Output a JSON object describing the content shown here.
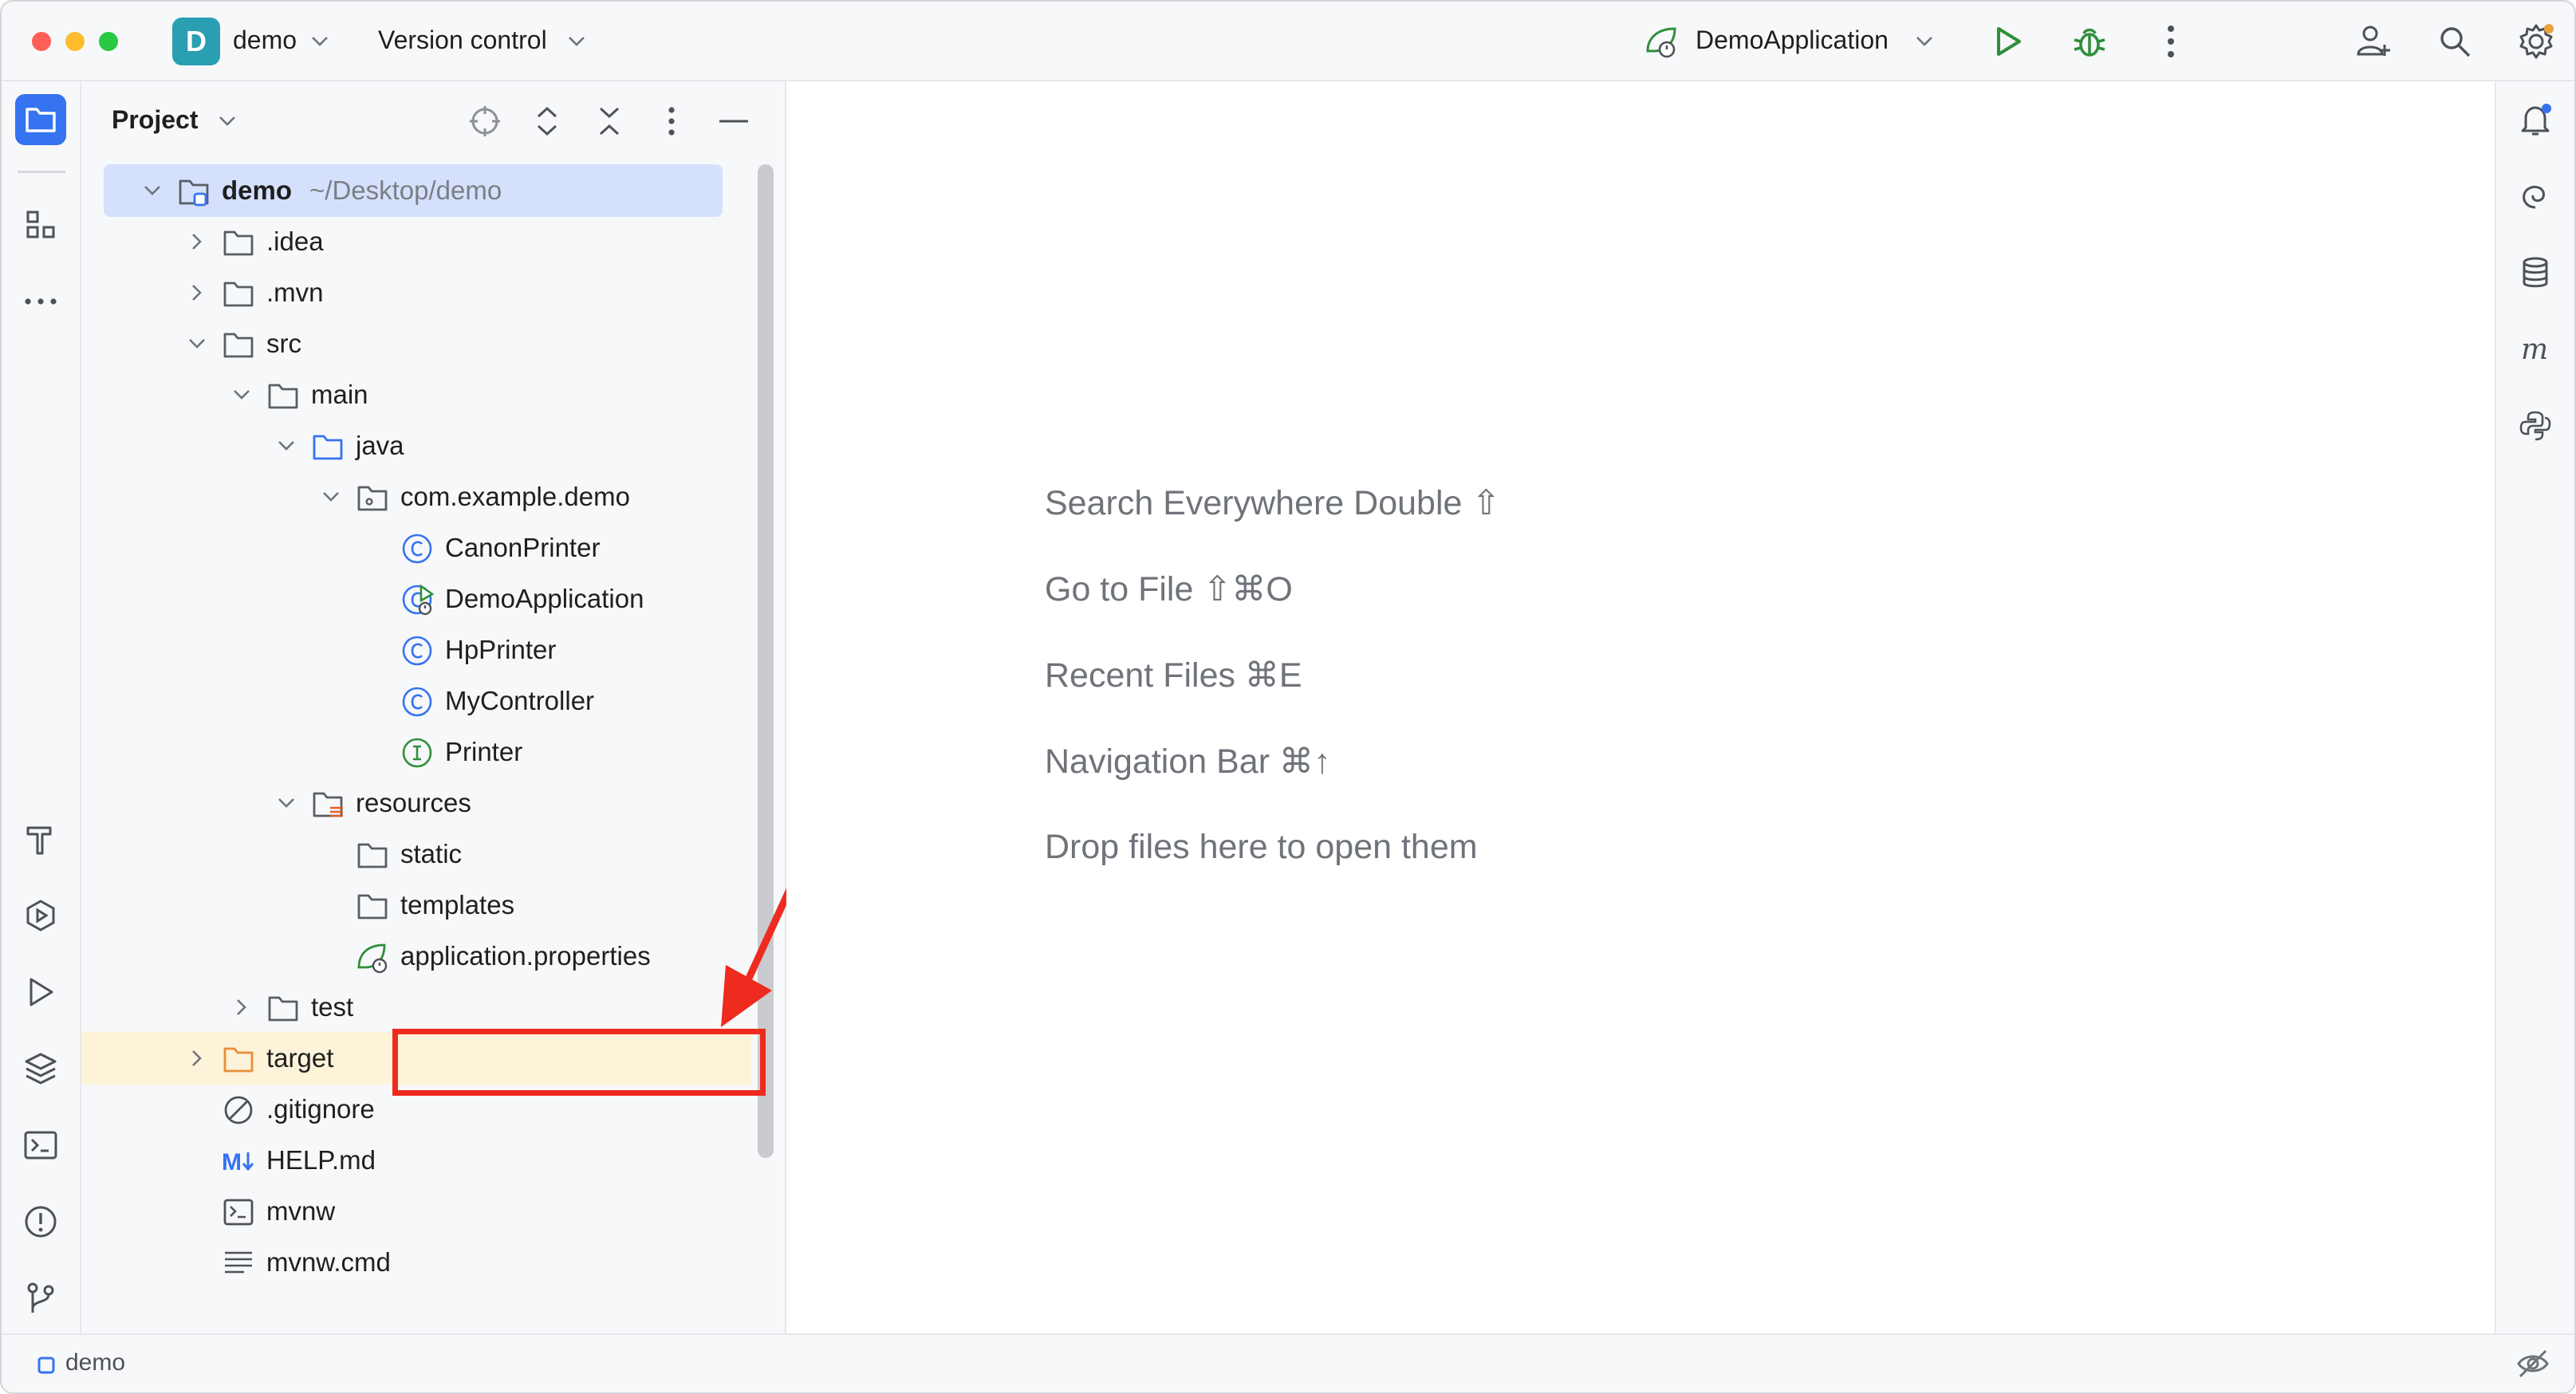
{
  "window": {
    "project_badge": "D",
    "project_name": "demo",
    "vcs_label": "Version control",
    "run_config": "DemoApplication"
  },
  "panel": {
    "title": "Project"
  },
  "tree": [
    {
      "label": "demo",
      "path": "~/Desktop/demo",
      "depth": 0,
      "expanded": true,
      "icon": "module-folder-icon"
    },
    {
      "label": ".idea",
      "depth": 1,
      "expanded": false,
      "icon": "folder-icon"
    },
    {
      "label": ".mvn",
      "depth": 1,
      "expanded": false,
      "icon": "folder-icon"
    },
    {
      "label": "src",
      "depth": 1,
      "expanded": true,
      "icon": "folder-icon"
    },
    {
      "label": "main",
      "depth": 2,
      "expanded": true,
      "icon": "folder-icon"
    },
    {
      "label": "java",
      "depth": 3,
      "expanded": true,
      "icon": "source-folder-icon"
    },
    {
      "label": "com.example.demo",
      "depth": 4,
      "expanded": true,
      "icon": "package-icon"
    },
    {
      "label": "CanonPrinter",
      "depth": 5,
      "icon": "class-icon"
    },
    {
      "label": "DemoApplication",
      "depth": 5,
      "icon": "spring-boot-class-icon"
    },
    {
      "label": "HpPrinter",
      "depth": 5,
      "icon": "class-icon"
    },
    {
      "label": "MyController",
      "depth": 5,
      "icon": "class-icon"
    },
    {
      "label": "Printer",
      "depth": 5,
      "icon": "interface-icon"
    },
    {
      "label": "resources",
      "depth": 3,
      "expanded": true,
      "icon": "resources-folder-icon"
    },
    {
      "label": "static",
      "depth": 4,
      "icon": "folder-icon"
    },
    {
      "label": "templates",
      "depth": 4,
      "icon": "folder-icon"
    },
    {
      "label": "application.properties",
      "depth": 4,
      "icon": "spring-properties-icon"
    },
    {
      "label": "test",
      "depth": 2,
      "expanded": false,
      "icon": "folder-icon"
    },
    {
      "label": "target",
      "depth": 1,
      "expanded": false,
      "icon": "excluded-folder-icon"
    },
    {
      "label": ".gitignore",
      "depth": 1,
      "icon": "gitignore-icon"
    },
    {
      "label": "HELP.md",
      "depth": 1,
      "icon": "markdown-icon"
    },
    {
      "label": "mvnw",
      "depth": 1,
      "icon": "shell-script-icon"
    },
    {
      "label": "mvnw.cmd",
      "depth": 1,
      "icon": "text-file-icon"
    }
  ],
  "editor_hints": [
    "Search Everywhere Double ⇧",
    "Go to File ⇧⌘O",
    "Recent Files ⌘E",
    "Navigation Bar ⌘↑",
    "Drop files here to open them"
  ],
  "statusbar": {
    "breadcrumb": "demo"
  },
  "colors": {
    "accent": "#3573f0",
    "selection": "#d5e1fc",
    "excluded": "#fdf3d9",
    "annotation_red": "#ee2b1e",
    "run_green": "#2f8f3a"
  }
}
